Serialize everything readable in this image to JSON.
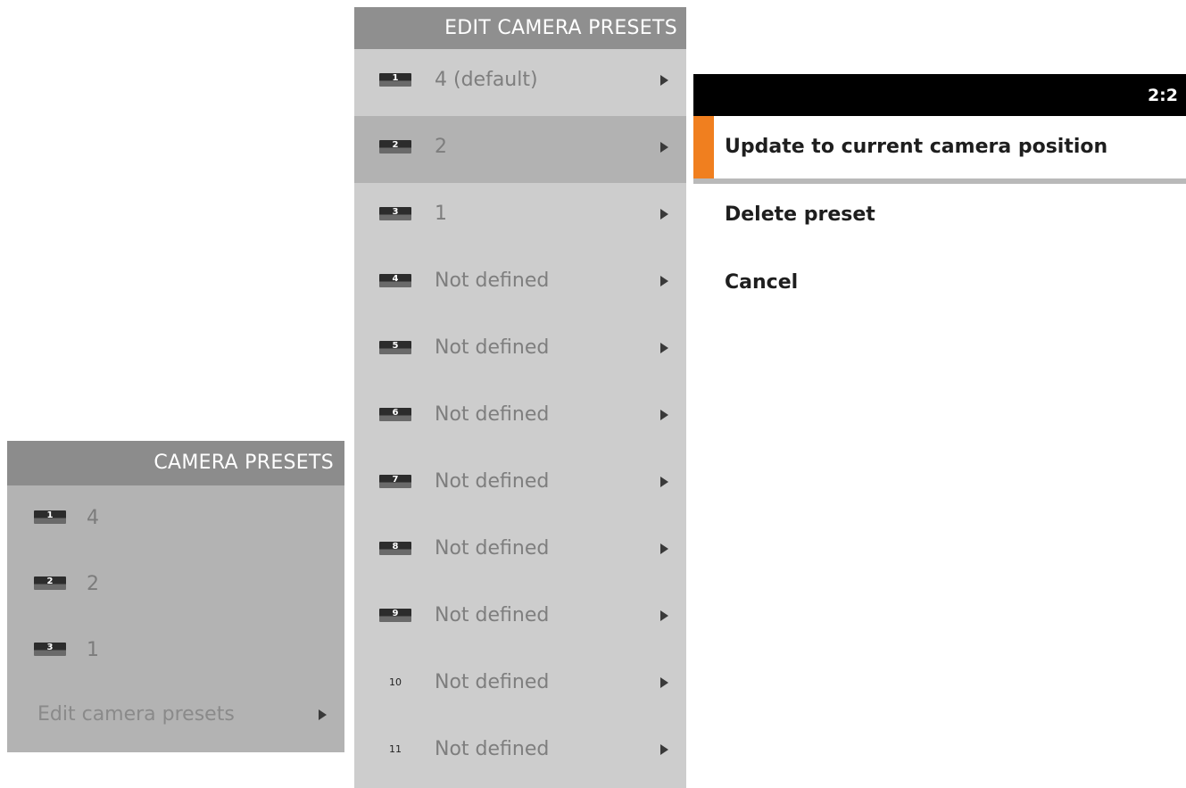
{
  "camera_presets": {
    "title": "CAMERA PRESETS",
    "items": [
      {
        "badge": "1",
        "label": "4"
      },
      {
        "badge": "2",
        "label": "2"
      },
      {
        "badge": "3",
        "label": "1"
      }
    ],
    "edit_link": "Edit camera presets"
  },
  "edit_camera_presets": {
    "title": "EDIT CAMERA PRESETS",
    "selected_index": 1,
    "items": [
      {
        "badge": "1",
        "label": "4 (default)"
      },
      {
        "badge": "2",
        "label": "2"
      },
      {
        "badge": "3",
        "label": "1"
      },
      {
        "badge": "4",
        "label": "Not defined"
      },
      {
        "badge": "5",
        "label": "Not defined"
      },
      {
        "badge": "6",
        "label": "Not defined"
      },
      {
        "badge": "7",
        "label": "Not defined"
      },
      {
        "badge": "8",
        "label": "Not defined"
      },
      {
        "badge": "9",
        "label": "Not defined"
      },
      {
        "badge": "10",
        "label": "Not defined"
      },
      {
        "badge": "11",
        "label": "Not defined"
      }
    ]
  },
  "preset_actions": {
    "page_indicator": "2:2",
    "selected_index": 0,
    "items": [
      {
        "label": "Update to current camera position"
      },
      {
        "label": "Delete preset"
      },
      {
        "label": "Cancel"
      }
    ]
  },
  "colors": {
    "focus_accent": "#f07f1f",
    "header_gray": "#8c8c8c",
    "panel_gray": "#b3b3b3",
    "menu_gray": "#cdcdcd",
    "selected_gray": "#b2b2b2"
  },
  "icons": {
    "submenu_arrow": "chevron-right-icon",
    "preset_badge": "preset-number-icon"
  }
}
